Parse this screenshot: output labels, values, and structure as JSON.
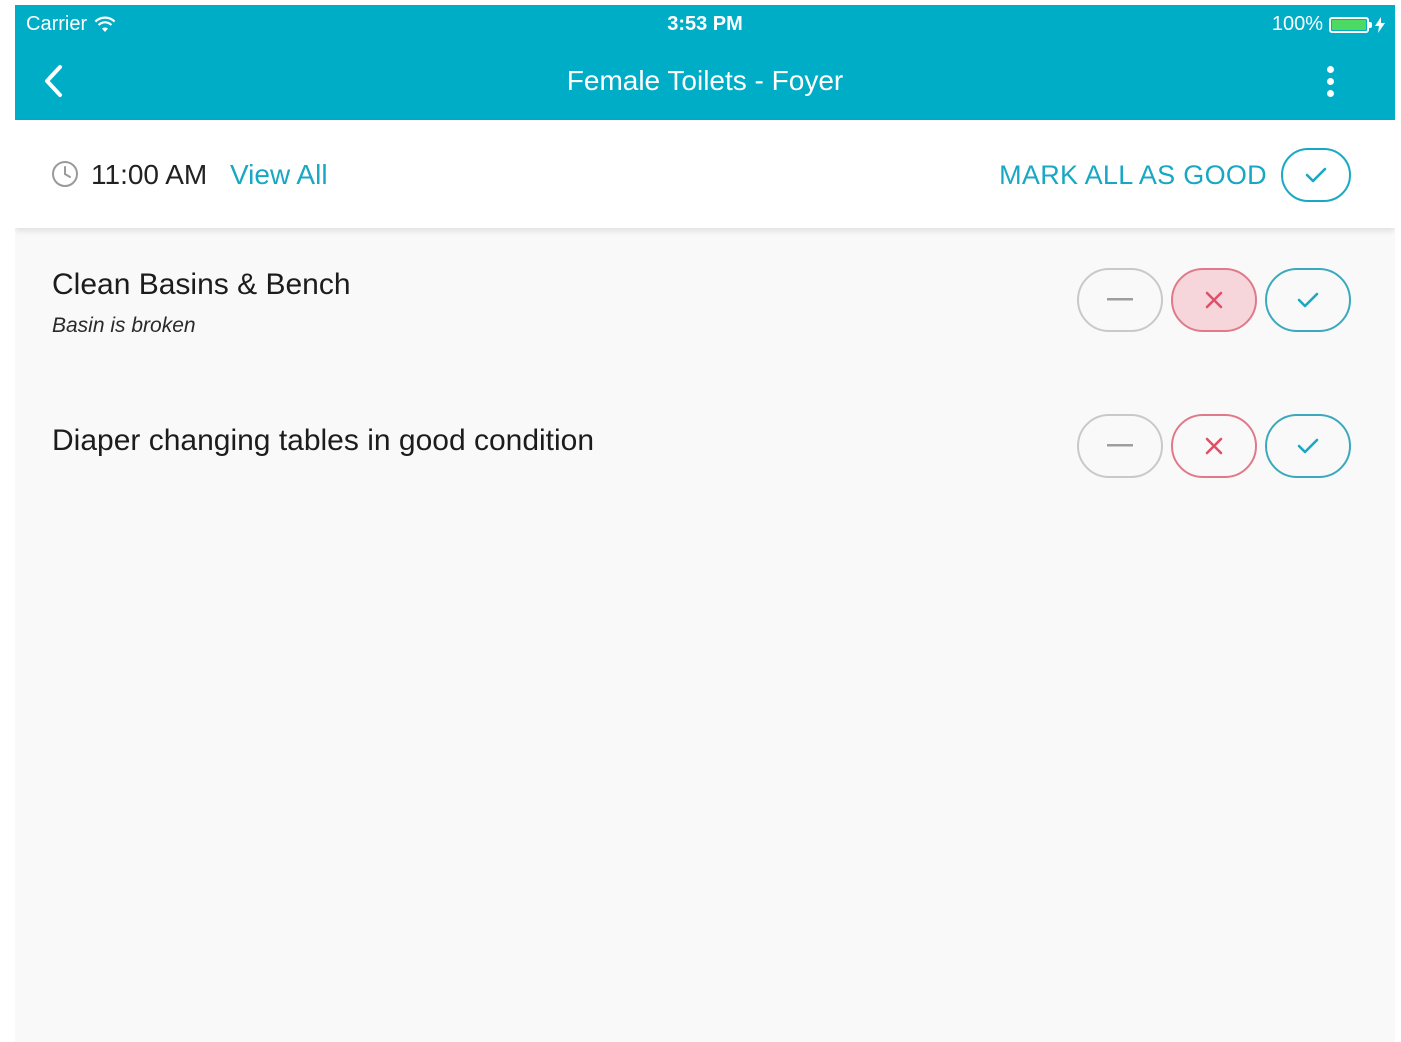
{
  "status_bar": {
    "carrier": "Carrier",
    "time": "3:53 PM",
    "battery": "100%"
  },
  "nav": {
    "title": "Female Toilets - Foyer"
  },
  "timebar": {
    "time": "11:00 AM",
    "view_all": "View All",
    "mark_all": "MARK ALL AS GOOD"
  },
  "items": [
    {
      "title": "Clean Basins & Bench",
      "note": "Basin is broken",
      "selected": "bad"
    },
    {
      "title": "Diaper changing tables in good condition",
      "note": "",
      "selected": "none"
    }
  ],
  "colors": {
    "header": "#00adc7",
    "accent": "#18a8c4",
    "bad": "#e07a8a",
    "bad_fill": "#f7d6db",
    "battery": "#4cd964"
  }
}
